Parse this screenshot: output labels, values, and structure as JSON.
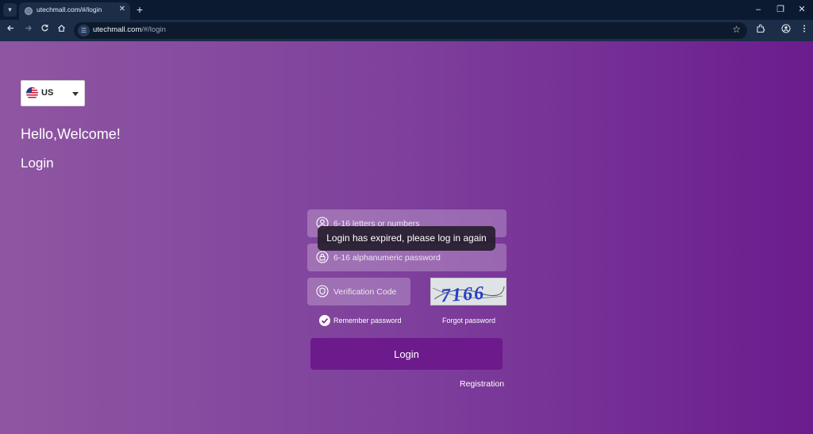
{
  "browser": {
    "tab_title": "utechmall.com/#/login",
    "tab_close": "✕",
    "new_tab": "+",
    "url_host": "utechmall.com",
    "url_path": "/#/login",
    "window_controls": {
      "minimize": "–",
      "restore": "❐",
      "close": "✕"
    }
  },
  "page": {
    "language": {
      "code": "US",
      "flag_icon": "us-flag-icon"
    },
    "greeting": "Hello,Welcome!",
    "heading": "Login",
    "fields": {
      "username": {
        "placeholder": "6-16 letters or numbers",
        "icon": "user-icon"
      },
      "password": {
        "placeholder": "6-16 alphanumeric password",
        "icon": "lock-icon"
      },
      "verification": {
        "placeholder": "Verification Code",
        "icon": "shield-icon"
      }
    },
    "captcha_code": "7166",
    "remember_label": "Remember password",
    "remember_checked": true,
    "forgot_label": "Forgot password",
    "login_button": "Login",
    "register_link": "Registration",
    "toast": "Login has expired, please log in again"
  },
  "colors": {
    "gradient_left": "#8e56a2",
    "gradient_right": "#6b1c8e",
    "button": "#6c1a8c",
    "toast_bg": "#261e2e",
    "chrome_dark": "#0b1a30",
    "chrome_toolbar": "#1c2d48"
  }
}
